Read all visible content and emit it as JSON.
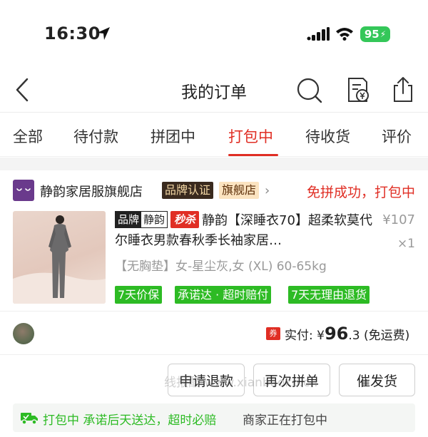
{
  "status_bar": {
    "time": "16:30",
    "battery": "95"
  },
  "header": {
    "title": "我的订单"
  },
  "tabs": [
    {
      "label": "全部"
    },
    {
      "label": "待付款"
    },
    {
      "label": "拼团中"
    },
    {
      "label": "打包中",
      "active": true
    },
    {
      "label": "待收货"
    },
    {
      "label": "评价"
    }
  ],
  "order": {
    "shop_name": "静韵家居服旗舰店",
    "badge_brand": "品牌认证",
    "badge_flagship": "旗舰店",
    "status": "免拼成功，打包中",
    "product": {
      "tag_brand_a": "品牌",
      "tag_brand_b": "静韵",
      "tag_flash": "秒杀",
      "title": "静韵【深睡衣70】超柔软莫代尔睡衣男款春秋季长袖家居…",
      "price": "¥107",
      "quantity": "×1",
      "spec": "【无胸垫】女-星尘灰,女 (XL) 60-65kg",
      "services": [
        "7天价保",
        "承诺达 · 超时赔付",
        "7天无理由退货"
      ]
    },
    "payment": {
      "coupon": "券",
      "label": "实付: ",
      "currency": "¥",
      "amount_int": "96",
      "amount_dec": ".3",
      "shipping": " (免运费)"
    },
    "actions": [
      "申请退款",
      "再次拼单",
      "催发货"
    ],
    "watermark": "线报酷 www.xianbaoku.cn",
    "notice": {
      "status_text": "打包中 承诺后天送达，超时必赔",
      "detail": "商家正在打包中"
    }
  },
  "colors": {
    "accent": "#e02e24",
    "green": "#2dbb24"
  }
}
